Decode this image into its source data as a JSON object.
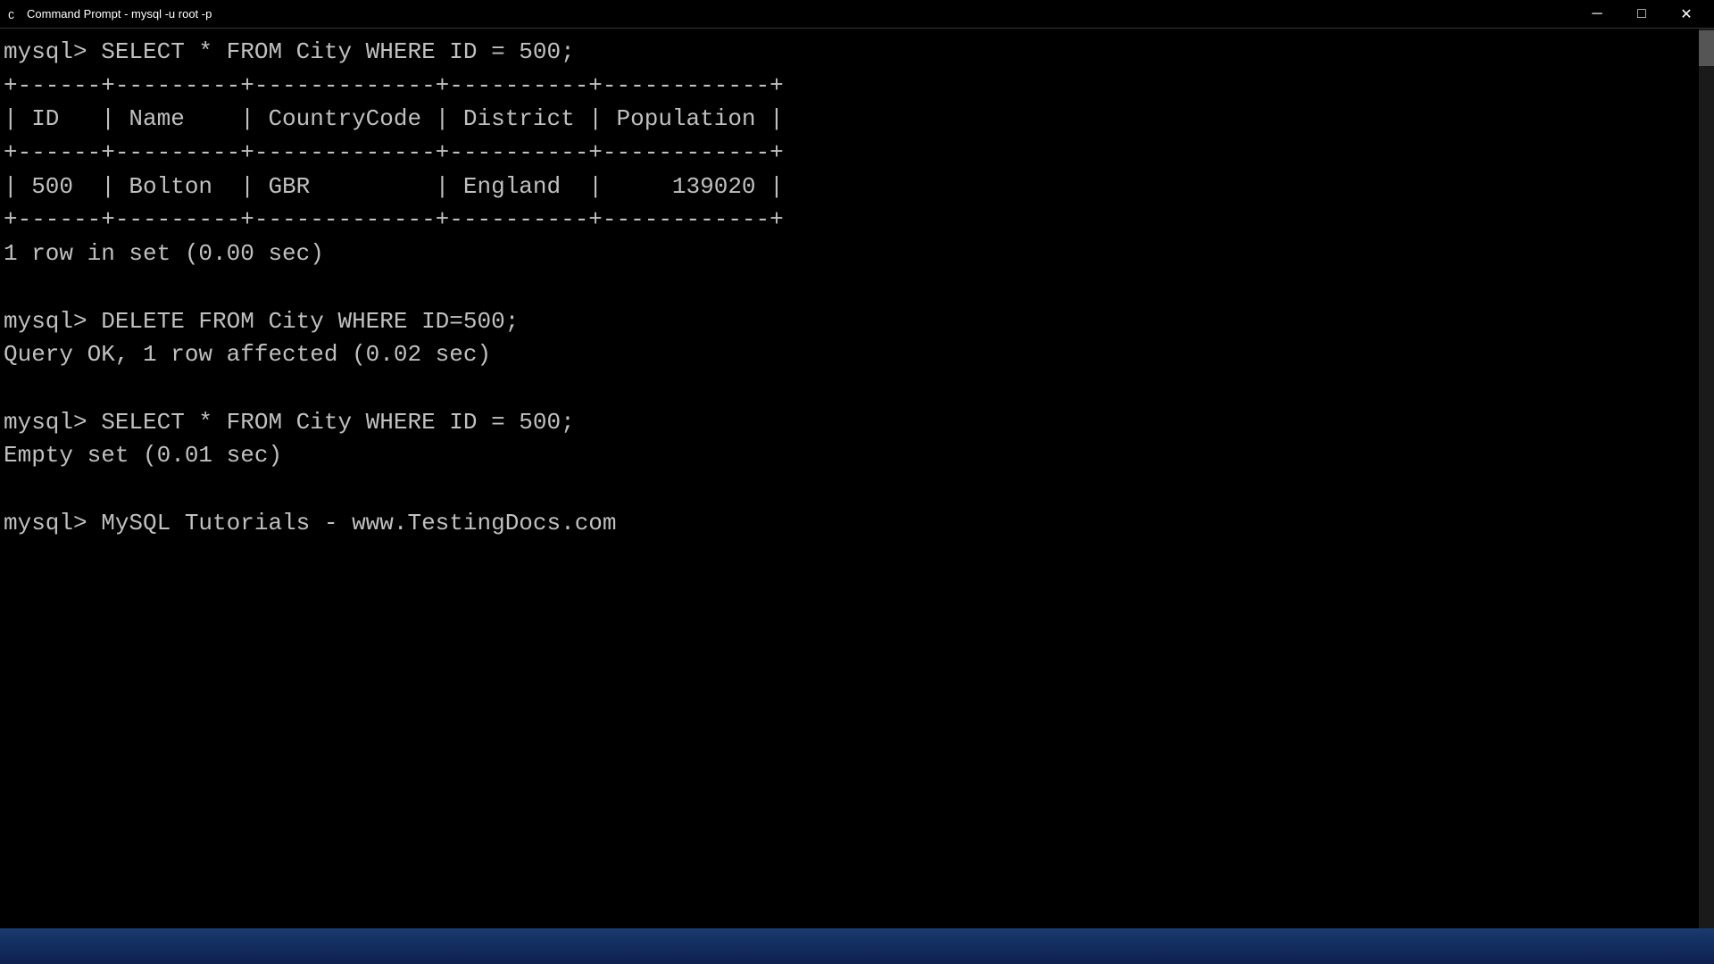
{
  "titleBar": {
    "icon": "⊞",
    "title": "Command Prompt - mysql  -u root -p",
    "minimizeLabel": "─",
    "maximizeLabel": "□",
    "closeLabel": "✕"
  },
  "terminal": {
    "line1": "mysql> SELECT * FROM City WHERE ID = 500;",
    "line2": "+------+---------+-------------+----------+------------+",
    "line3": "| ID   | Name    | CountryCode | District | Population |",
    "line4": "+------+---------+-------------+----------+------------+",
    "line5": "| 500  | Bolton  | GBR         | England  |     139020 |",
    "line6": "+------+---------+-------------+----------+------------+",
    "line7": "1 row in set (0.00 sec)",
    "line8": "",
    "line9": "mysql> DELETE FROM City WHERE ID=500;",
    "line10": "Query OK, 1 row affected (0.02 sec)",
    "line11": "",
    "line12": "mysql> SELECT * FROM City WHERE ID = 500;",
    "line13": "Empty set (0.01 sec)",
    "line14": "",
    "line15": "mysql> MySQL Tutorials - www.TestingDocs.com"
  }
}
